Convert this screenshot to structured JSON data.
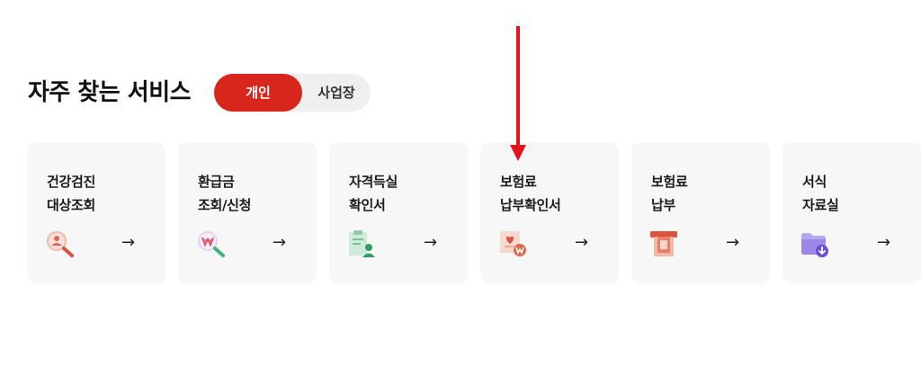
{
  "section": {
    "title": "자주 찾는 서비스"
  },
  "toggle": {
    "personal": "개인",
    "business": "사업장"
  },
  "cards": [
    {
      "line1": "건강검진",
      "line2": "대상조회",
      "icon": "magnifier-person-icon"
    },
    {
      "line1": "환급금",
      "line2": "조회/신청",
      "icon": "magnifier-won-icon"
    },
    {
      "line1": "자격득실",
      "line2": "확인서",
      "icon": "clipboard-person-icon"
    },
    {
      "line1": "보험료",
      "line2": "납부확인서",
      "icon": "document-won-icon"
    },
    {
      "line1": "보험료",
      "line2": "납부",
      "icon": "card-payment-icon"
    },
    {
      "line1": "서식",
      "line2": "자료실",
      "icon": "folder-download-icon"
    }
  ],
  "arrow_glyph": "→",
  "colors": {
    "accent": "#d9261c",
    "card_bg": "#f7f7f7",
    "toggle_bg": "#efefef"
  }
}
